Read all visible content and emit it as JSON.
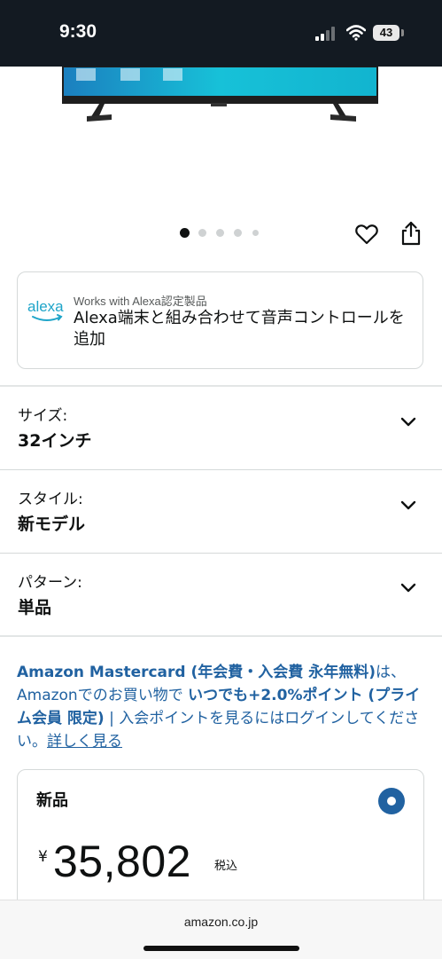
{
  "status_bar": {
    "time": "9:30",
    "battery": "43"
  },
  "carousel": {
    "total_dots": 5,
    "active_index": 0
  },
  "alexa": {
    "logo_text": "alexa",
    "subtitle": "Works with Alexa認定製品",
    "text": "Alexa端末と組み合わせて音声コントロールを追加"
  },
  "options": [
    {
      "label": "サイズ:",
      "value": "32インチ"
    },
    {
      "label": "スタイル:",
      "value": "新モデル"
    },
    {
      "label": "パターン:",
      "value": "単品"
    }
  ],
  "promo": {
    "bold_1": "Amazon Mastercard (年会費・入会費 永年無料)",
    "text_1": "は、Amazonでのお買い物で ",
    "bold_2": "いつでも+2.0%ポイント (プライム会員 限定)",
    "text_2": " | 入会ポイントを見るにはログインしてください。",
    "link": "詳しく見る"
  },
  "price_box": {
    "label": "新品",
    "currency": "¥",
    "price": "35,802",
    "tax_note": "税込"
  },
  "browser": {
    "domain": "amazon.co.jp"
  },
  "colors": {
    "status_bar_bg": "#131a22",
    "link_blue": "#2162a1",
    "tv_screen": "#14b9d4"
  }
}
